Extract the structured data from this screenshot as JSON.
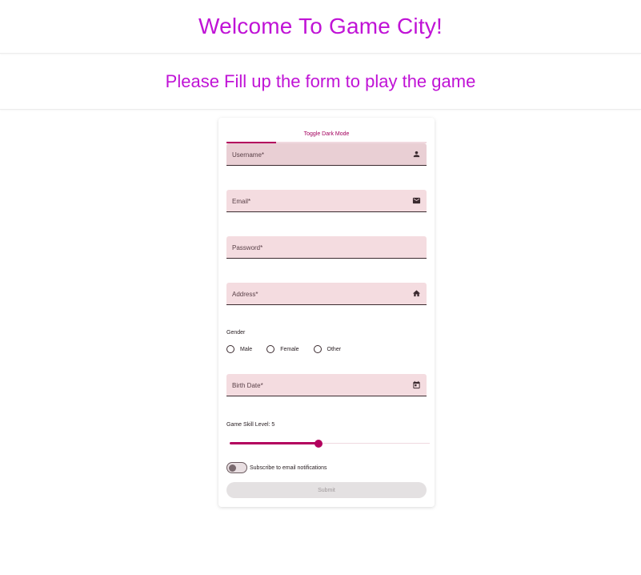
{
  "header": {
    "title": "Welcome To Game City!"
  },
  "subheader": {
    "text": "Please Fill up the form to play the game"
  },
  "form": {
    "tab_label": "Toggle Dark Mode",
    "fields": {
      "username": {
        "label": "Username*",
        "icon": "person-icon"
      },
      "email": {
        "label": "Email*",
        "icon": "mail-icon"
      },
      "password": {
        "label": "Password*"
      },
      "address": {
        "label": "Address*",
        "icon": "home-icon"
      },
      "birthdate": {
        "label": "Birth Date*",
        "icon": "calendar-icon"
      }
    },
    "gender": {
      "label": "Gender",
      "options": [
        "Male",
        "Female",
        "Other"
      ]
    },
    "skill": {
      "label": "Game Skill Level: 5",
      "value": 5,
      "min": 0,
      "max": 10
    },
    "subscribe": {
      "label": "Subscribe to email notifications",
      "checked": false
    },
    "submit_label": "Submit"
  },
  "colors": {
    "accent": "#b3005e",
    "heading": "#c013d6",
    "field_bg": "#f4dce0"
  }
}
